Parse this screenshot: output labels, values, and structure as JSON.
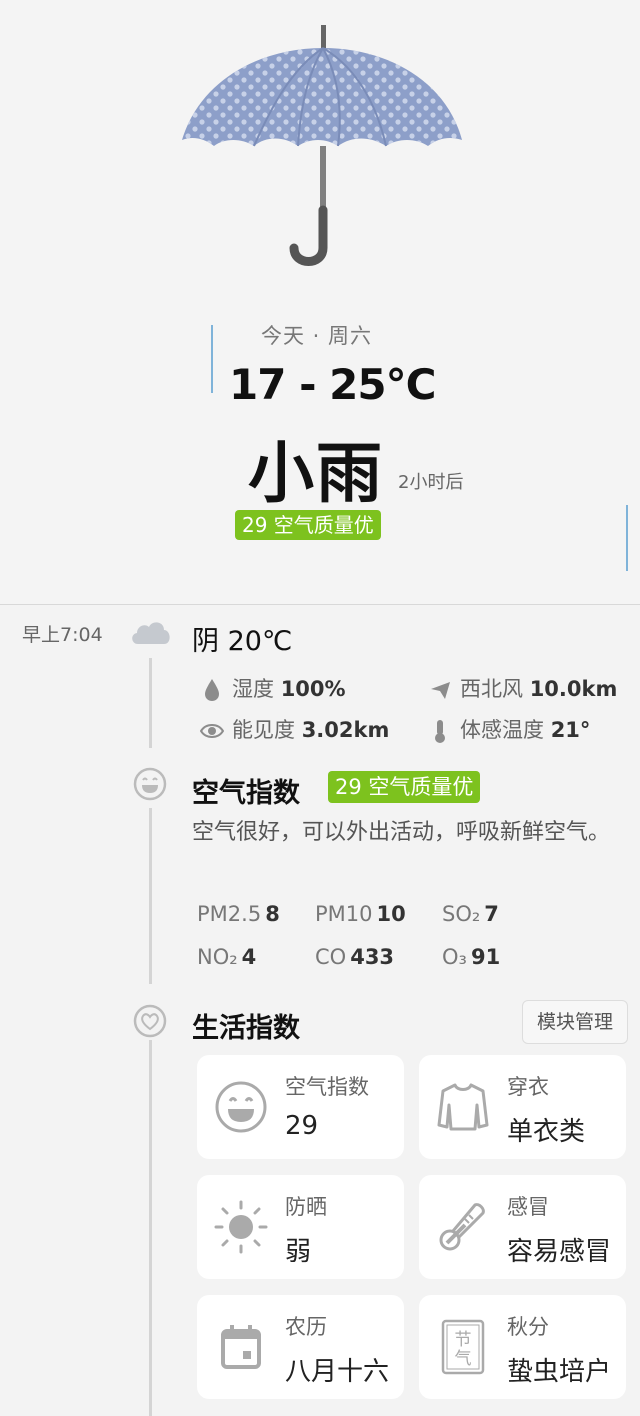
{
  "hero": {
    "day_label": "今天 · 周六",
    "temp_range": "17 - 25℃",
    "condition": "小雨",
    "condition_time": "2小时后",
    "aqi_badge": "29 空气质量优"
  },
  "hourly": {
    "time": "早上7:04",
    "icon": "cloud-icon",
    "weather": "阴 20℃",
    "details": [
      {
        "icon": "humidity-icon",
        "label": "湿度",
        "value": "100%"
      },
      {
        "icon": "wind-icon",
        "label": "西北风",
        "value": "10.0km"
      },
      {
        "icon": "visibility-icon",
        "label": "能见度",
        "value": "3.02km"
      },
      {
        "icon": "thermometer-icon",
        "label": "体感温度",
        "value": "21°"
      }
    ]
  },
  "air": {
    "title": "空气指数",
    "badge": "29 空气质量优",
    "description": "空气很好，可以外出活动，呼吸新鲜空气。",
    "pollutants": [
      {
        "name": "PM2.5",
        "value": "8"
      },
      {
        "name": "PM10",
        "value": "10"
      },
      {
        "name": "SO₂",
        "value": "7"
      },
      {
        "name": "NO₂",
        "value": "4"
      },
      {
        "name": "CO",
        "value": "433"
      },
      {
        "name": "O₃",
        "value": "91"
      }
    ]
  },
  "life": {
    "title": "生活指数",
    "manage_label": "模块管理",
    "cards": [
      {
        "icon": "smiley-icon",
        "title": "空气指数",
        "value": "29"
      },
      {
        "icon": "shirt-icon",
        "title": "穿衣",
        "value": "单衣类"
      },
      {
        "icon": "sun-icon",
        "title": "防晒",
        "value": "弱"
      },
      {
        "icon": "thermometer-icon",
        "title": "感冒",
        "value": "容易感冒"
      },
      {
        "icon": "calendar-icon",
        "title": "农历",
        "value": "八月十六"
      },
      {
        "icon": "solar-term-icon",
        "title": "秋分",
        "value": "蛰虫培户"
      }
    ],
    "solar_term_glyphs": "节气"
  },
  "colors": {
    "aqi_green": "#7dc21e",
    "accent_blue": "#7fb3d9",
    "umbrella": "#8d9fc9"
  }
}
